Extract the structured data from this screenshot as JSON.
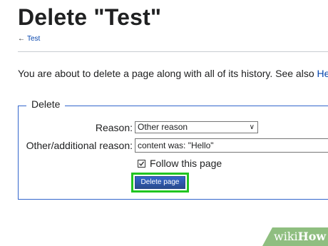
{
  "page": {
    "title": "Delete \"Test\"",
    "back_link_arrow": "←",
    "back_link_label": "Test",
    "intro_text": "You are about to delete a page along with all of its history. See also ",
    "intro_link": "Help"
  },
  "form": {
    "legend": "Delete",
    "reason_label": "Reason:",
    "reason_selected": "Other reason",
    "other_reason_label": "Other/additional reason:",
    "other_reason_value": "content was: \"Hello\"",
    "follow_checked": true,
    "follow_label": "Follow this page",
    "submit_label": "Delete page"
  },
  "highlight_color": "#21c521",
  "watermark": {
    "part1": "wiki",
    "part2": "How"
  }
}
